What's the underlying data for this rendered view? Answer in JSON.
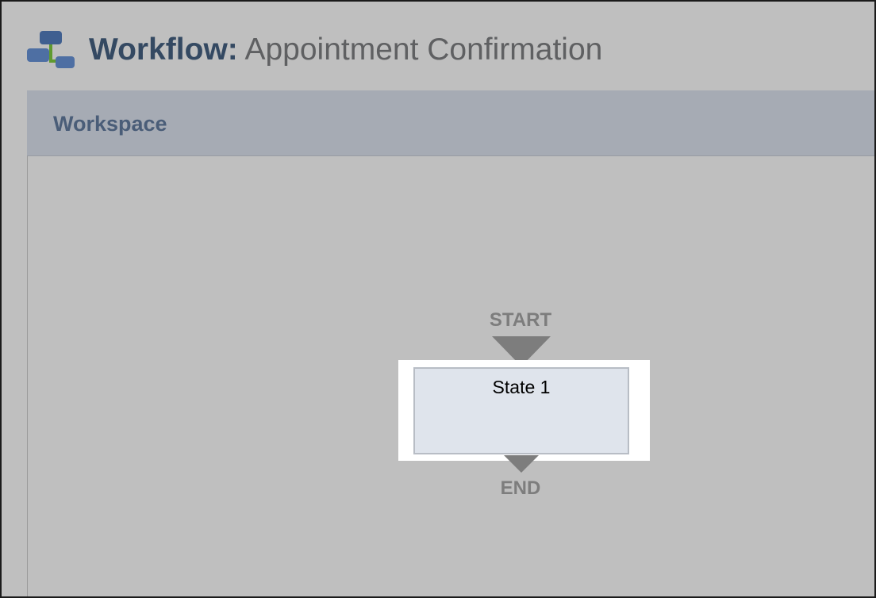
{
  "header": {
    "icon": "workflow-icon",
    "title_prefix": "Workflow:",
    "title_name": "Appointment Confirmation"
  },
  "workspace": {
    "label": "Workspace"
  },
  "diagram": {
    "start_label": "START",
    "end_label": "END",
    "states": [
      {
        "label": "State 1"
      }
    ]
  },
  "colors": {
    "background": "#bfbfbf",
    "title_prefix": "#344962",
    "title_name": "#5f6062",
    "workspace_bar": "#a6abb4",
    "workspace_label": "#4a5d78",
    "state_fill": "#dfe4ec",
    "connector": "#7d7d7d"
  }
}
